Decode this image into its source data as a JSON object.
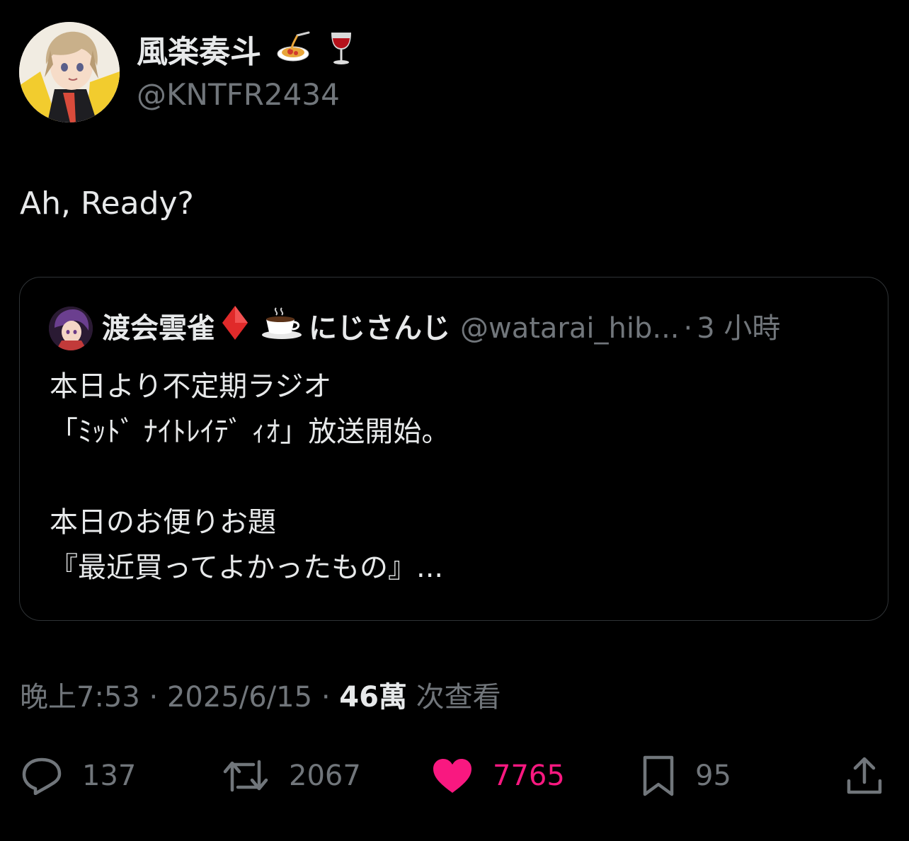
{
  "author": {
    "display_name": "風楽奏斗",
    "name_emojis": [
      "pasta-icon",
      "wine-glass-icon"
    ],
    "handle": "@KNTFR2434"
  },
  "tweet": {
    "text": "Ah, Ready?"
  },
  "quote": {
    "display_name": "渡会雲雀",
    "name_emojis": [
      "diamond-icon",
      "coffee-icon"
    ],
    "name_suffix": "にじさんじ",
    "handle": "@watarai_hib...",
    "separator": "·",
    "time": "3 小時",
    "lines": [
      "本日より不定期ラジオ",
      "「ﾐｯﾄﾞ ﾅｲﾄﾚｲﾃﾞ ｨｵ」放送開始。",
      "",
      "本日のお便りお題",
      "『最近買ってよかったもの』..."
    ]
  },
  "meta": {
    "time": "晚上7:53",
    "sep1": "·",
    "date": "2025/6/15",
    "sep2": "·",
    "views_count": "46萬",
    "views_label": "次查看"
  },
  "actions": {
    "replies": "137",
    "retweets": "2067",
    "likes": "7765",
    "bookmarks": "95"
  },
  "colors": {
    "background": "#000000",
    "text": "#e7e9ea",
    "secondary": "#71767b",
    "like": "#f91880",
    "border": "#2f3336"
  }
}
